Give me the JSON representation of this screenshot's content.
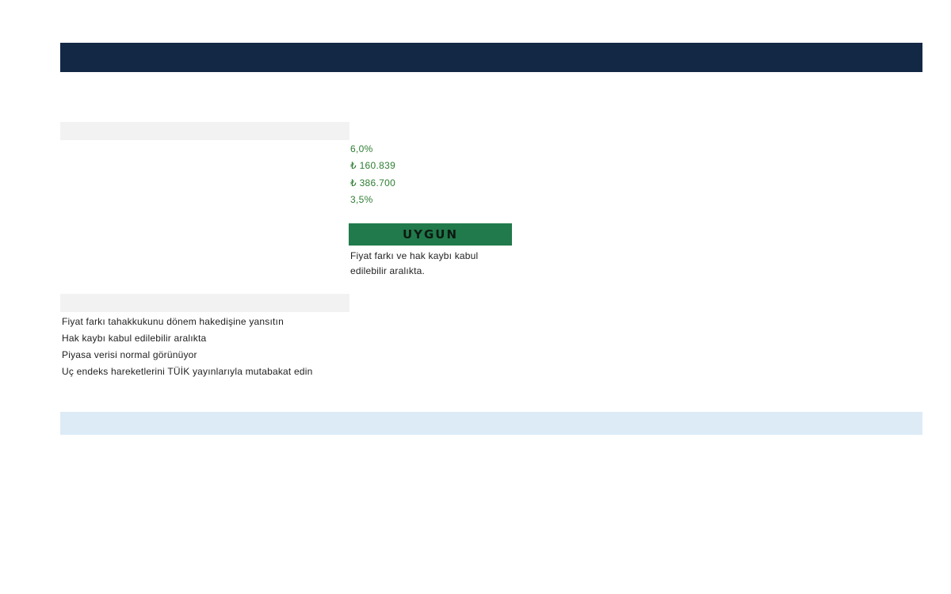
{
  "metrics": {
    "rate": "6,0%",
    "price_difference": "₺ 160.839",
    "amount": "₺ 386.700",
    "loss_ratio": "3,5%"
  },
  "status": {
    "label": "UYGUN",
    "note": "Fiyat farkı ve hak kaybı kabul edilebilir aralıkta.",
    "color": "#217a4b"
  },
  "actions": [
    "Fiyat farkı tahakkukunu dönem hakedişine yansıtın",
    "Hak kaybı kabul edilebilir aralıkta",
    "Piyasa verisi normal görünüyor",
    "Uç endeks hareketlerini TÜİK yayınlarıyla mutabakat edin"
  ],
  "colors": {
    "header": "#132844",
    "section_band": "#f2f2f2",
    "metric_text": "#2e7d32",
    "footer_band": "#ddebf6"
  }
}
